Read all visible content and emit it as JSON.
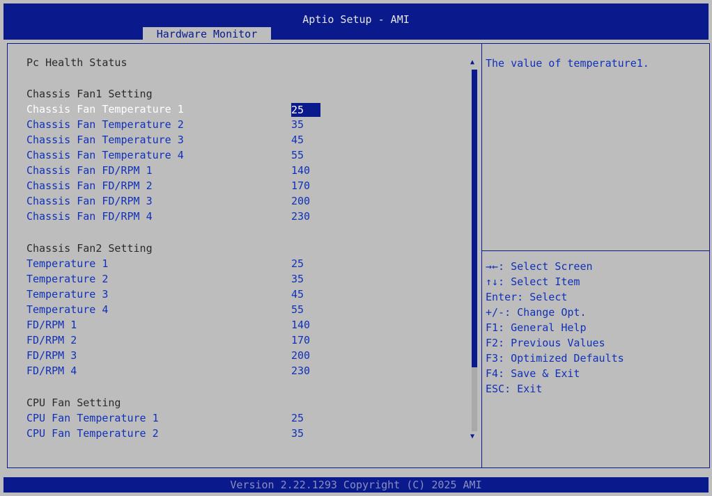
{
  "header": {
    "title": "Aptio Setup - AMI",
    "active_tab": "Hardware Monitor"
  },
  "main": {
    "section_title": "Pc Health Status",
    "groups": [
      {
        "heading": "Chassis Fan1 Setting",
        "items": [
          {
            "label": "Chassis Fan Temperature 1",
            "value": "25"
          },
          {
            "label": "Chassis Fan Temperature 2",
            "value": "35"
          },
          {
            "label": "Chassis Fan Temperature 3",
            "value": "45"
          },
          {
            "label": "Chassis Fan Temperature 4",
            "value": "55"
          },
          {
            "label": "Chassis Fan FD/RPM 1",
            "value": "140"
          },
          {
            "label": "Chassis Fan FD/RPM 2",
            "value": "170"
          },
          {
            "label": "Chassis Fan FD/RPM 3",
            "value": "200"
          },
          {
            "label": "Chassis Fan FD/RPM 4",
            "value": "230"
          }
        ]
      },
      {
        "heading": "Chassis Fan2 Setting",
        "items": [
          {
            "label": "Temperature 1",
            "value": "25"
          },
          {
            "label": "Temperature 2",
            "value": "35"
          },
          {
            "label": "Temperature 3",
            "value": "45"
          },
          {
            "label": "Temperature 4",
            "value": "55"
          },
          {
            "label": "FD/RPM 1",
            "value": "140"
          },
          {
            "label": "FD/RPM 2",
            "value": "170"
          },
          {
            "label": "FD/RPM 3",
            "value": "200"
          },
          {
            "label": "FD/RPM 4",
            "value": "230"
          }
        ]
      },
      {
        "heading": "CPU Fan Setting",
        "items": [
          {
            "label": "CPU Fan Temperature 1",
            "value": "25"
          },
          {
            "label": "CPU Fan Temperature 2",
            "value": "35"
          }
        ]
      }
    ]
  },
  "help": {
    "description": "The value of temperature1.",
    "keys": [
      "→←: Select Screen",
      "↑↓: Select Item",
      "Enter: Select",
      "+/-: Change Opt.",
      "F1: General Help",
      "F2: Previous Values",
      "F3: Optimized Defaults",
      "F4: Save & Exit",
      "ESC: Exit"
    ]
  },
  "icons": {
    "scroll_up": "scroll-up-arrow-icon",
    "scroll_down": "scroll-down-arrow-icon"
  },
  "colors": {
    "bios_blue": "#0a1a8c",
    "background": "#bdbdbd",
    "item_text": "#1030b8"
  },
  "footer": {
    "version": "Version 2.22.1293 Copyright (C) 2025 AMI"
  }
}
